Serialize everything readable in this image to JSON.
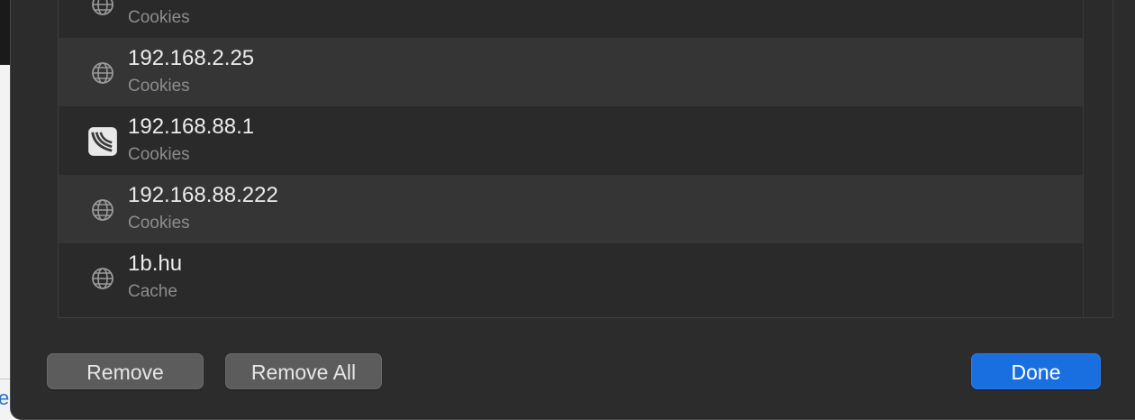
{
  "website_data": {
    "items": [
      {
        "title": "",
        "subtitle": "Cookies",
        "icon": "globe-icon"
      },
      {
        "title": "192.168.2.25",
        "subtitle": "Cookies",
        "icon": "globe-icon"
      },
      {
        "title": "192.168.88.1",
        "subtitle": "Cookies",
        "icon": "router-favicon-icon"
      },
      {
        "title": "192.168.88.222",
        "subtitle": "Cookies",
        "icon": "globe-icon"
      },
      {
        "title": "1b.hu",
        "subtitle": "Cache",
        "icon": "globe-icon"
      }
    ]
  },
  "buttons": {
    "remove_label": "Remove",
    "remove_all_label": "Remove All",
    "done_label": "Done"
  },
  "background": {
    "partial_text": "e"
  },
  "colors": {
    "sheet_bg": "#2c2c2c",
    "row_alt_bg": "#353535",
    "accent": "#1a6fe0"
  }
}
